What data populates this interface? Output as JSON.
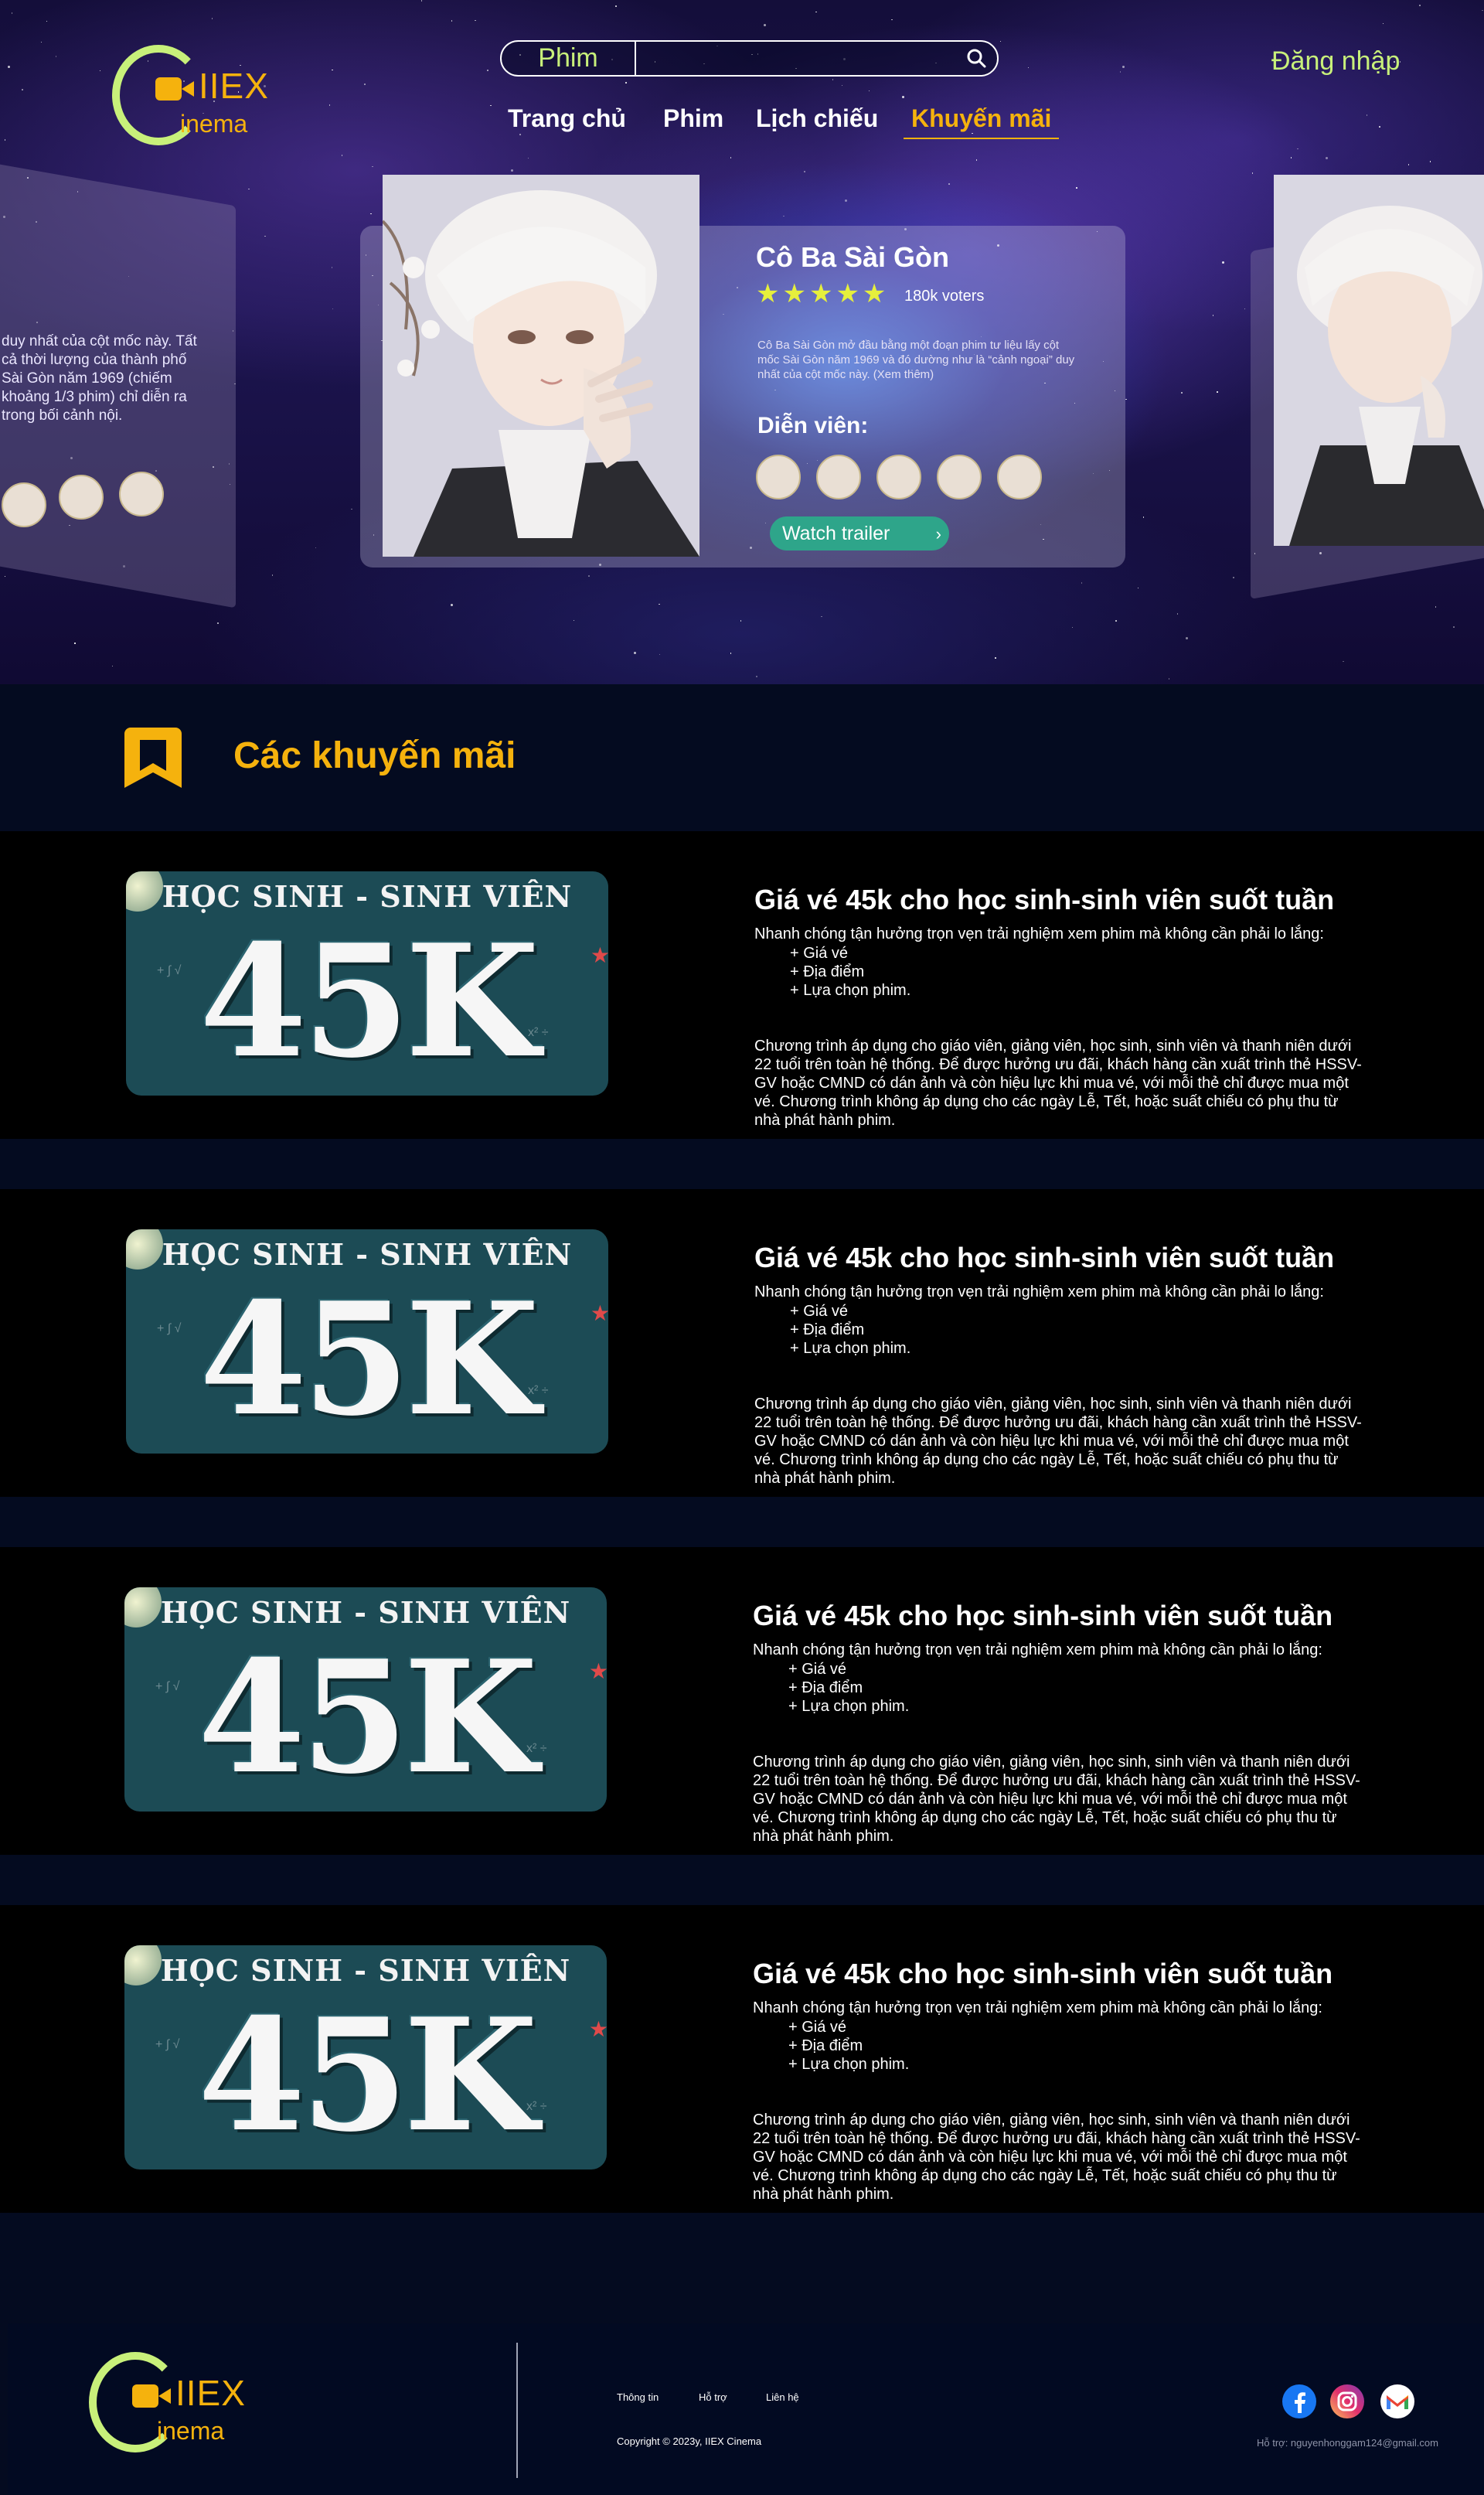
{
  "brand": {
    "logo_text": "IIEX",
    "logo_sub": "inema",
    "accent": "#f5b20d",
    "lime": "#c8f07a"
  },
  "header": {
    "search": {
      "category": "Phim",
      "placeholder": "",
      "icon": "search-icon"
    },
    "nav": [
      {
        "label": "Trang chủ",
        "active": false
      },
      {
        "label": "Phim",
        "active": false
      },
      {
        "label": "Lịch chiếu",
        "active": false
      },
      {
        "label": "Khuyến mãi",
        "active": true
      }
    ],
    "login": "Đăng nhập"
  },
  "hero": {
    "side_left_text": "duy nhất của cột mốc này. Tất cả thời lượng của thành phố Sài Gòn năm 1969 (chiếm khoảng 1/3 phim) chỉ diễn ra trong bối cảnh nội.",
    "movie": {
      "title": "Cô Ba Sài Gòn",
      "rating": 5,
      "stars_text": "★★★★★",
      "voters": "180k voters",
      "description": "Cô Ba Sài Gòn mở đầu bằng một đoạn phim tư liệu lấy cột mốc Sài Gòn năm 1969 và đó dường như là “cảnh ngoại” duy nhất của cột mốc này. (Xem thêm)",
      "cast_label": "Diễn viên:",
      "cast_count": 5,
      "trailer_button": "Watch trailer"
    }
  },
  "promotions": {
    "section_title": "Các khuyến mãi",
    "image_text": {
      "top": "HỌC SINH - SINH VIÊN",
      "big": "45K"
    },
    "items": [
      {
        "title": "Giá vé 45k cho học sinh-sinh viên suốt tuần",
        "intro": "Nhanh chóng tận hưởng trọn vẹn trải nghiệm xem phim mà không cần phải lo lắng:",
        "bullets": [
          "+ Giá vé",
          "+ Địa điểm",
          "+ Lựa chọn phim."
        ],
        "body": "Chương trình áp dụng cho giáo viên, giảng viên, học sinh, sinh viên và thanh niên dưới 22 tuổi trên toàn hệ thống. Để được hưởng ưu đãi, khách hàng cần xuất trình thẻ HSSV-GV hoặc CMND có dán ảnh và còn hiệu lực khi mua vé, với mỗi thẻ chỉ được mua một vé. Chương trình không áp dụng cho các ngày Lễ, Tết, hoặc suất chiếu có phụ thu từ nhà phát hành phim."
      },
      {
        "title": "Giá vé 45k cho học sinh-sinh viên suốt tuần",
        "intro": "Nhanh chóng tận hưởng trọn vẹn trải nghiệm xem phim mà không cần phải lo lắng:",
        "bullets": [
          "+ Giá vé",
          "+ Địa điểm",
          "+ Lựa chọn phim."
        ],
        "body": "Chương trình áp dụng cho giáo viên, giảng viên, học sinh, sinh viên và thanh niên dưới 22 tuổi trên toàn hệ thống. Để được hưởng ưu đãi, khách hàng cần xuất trình thẻ HSSV-GV hoặc CMND có dán ảnh và còn hiệu lực khi mua vé, với mỗi thẻ chỉ được mua một vé. Chương trình không áp dụng cho các ngày Lễ, Tết, hoặc suất chiếu có phụ thu từ nhà phát hành phim."
      },
      {
        "title": "Giá vé 45k cho học sinh-sinh viên suốt tuần",
        "intro": "Nhanh chóng tận hưởng trọn vẹn trải nghiệm xem phim mà không cần phải lo lắng:",
        "bullets": [
          "+ Giá vé",
          "+ Địa điểm",
          "+ Lựa chọn phim."
        ],
        "body": "Chương trình áp dụng cho giáo viên, giảng viên, học sinh, sinh viên và thanh niên dưới 22 tuổi trên toàn hệ thống. Để được hưởng ưu đãi, khách hàng cần xuất trình thẻ HSSV-GV hoặc CMND có dán ảnh và còn hiệu lực khi mua vé, với mỗi thẻ chỉ được mua một vé. Chương trình không áp dụng cho các ngày Lễ, Tết, hoặc suất chiếu có phụ thu từ nhà phát hành phim."
      },
      {
        "title": "Giá vé 45k cho học sinh-sinh viên suốt tuần",
        "intro": "Nhanh chóng tận hưởng trọn vẹn trải nghiệm xem phim mà không cần phải lo lắng:",
        "bullets": [
          "+ Giá vé",
          "+ Địa điểm",
          "+ Lựa chọn phim."
        ],
        "body": "Chương trình áp dụng cho giáo viên, giảng viên, học sinh, sinh viên và thanh niên dưới 22 tuổi trên toàn hệ thống. Để được hưởng ưu đãi, khách hàng cần xuất trình thẻ HSSV-GV hoặc CMND có dán ảnh và còn hiệu lực khi mua vé, với mỗi thẻ chỉ được mua một vé. Chương trình không áp dụng cho các ngày Lễ, Tết, hoặc suất chiếu có phụ thu từ nhà phát hành phim."
      }
    ]
  },
  "footer": {
    "links": [
      "Thông tin",
      "Hỗ trợ",
      "Liên hệ"
    ],
    "copyright": "Copyright © 2023y, IIEX Cinema",
    "support": "Hỗ trợ: nguyenhonggam124@gmail.com",
    "socials": [
      "facebook-icon",
      "instagram-icon",
      "gmail-icon"
    ]
  }
}
